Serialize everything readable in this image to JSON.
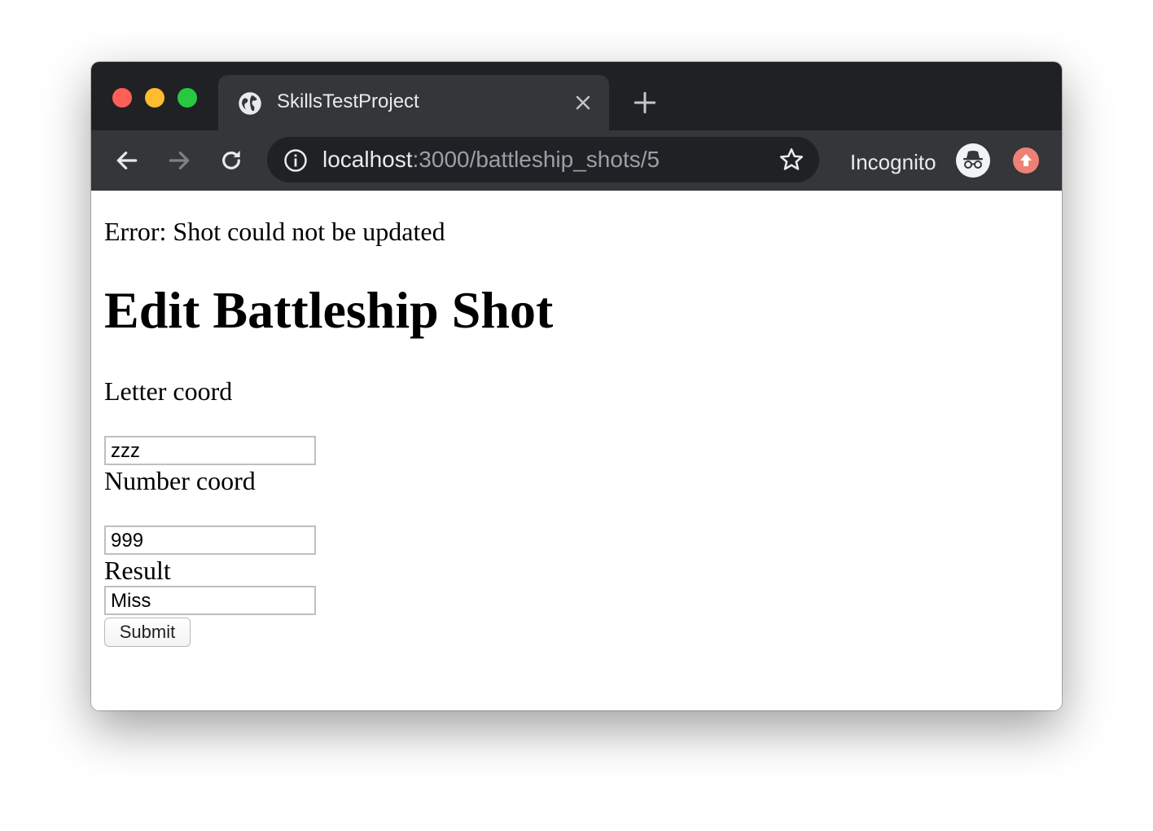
{
  "browser": {
    "tab_title": "SkillsTestProject",
    "url_host": "localhost",
    "url_path": ":3000/battleship_shots/5",
    "profile_label": "Incognito",
    "icons": {
      "tab_favicon": "globe-icon",
      "tab_close": "close-icon",
      "new_tab": "plus-icon",
      "back": "arrow-left-icon",
      "forward": "arrow-right-icon",
      "reload": "reload-icon",
      "site_info": "info-icon",
      "bookmark": "star-icon",
      "profile": "incognito-icon",
      "update": "arrow-up-icon"
    },
    "colors": {
      "titlebar": "#202124",
      "toolbar": "#35363a",
      "update_badge": "#ee8176"
    }
  },
  "page": {
    "error_message": "Error: Shot could not be updated",
    "title": "Edit Battleship Shot",
    "form": {
      "letter_coord": {
        "label": "Letter coord",
        "value": "zzz"
      },
      "number_coord": {
        "label": "Number coord",
        "value": "999"
      },
      "result": {
        "label": "Result",
        "value": "Miss"
      },
      "submit_label": "Submit"
    }
  }
}
